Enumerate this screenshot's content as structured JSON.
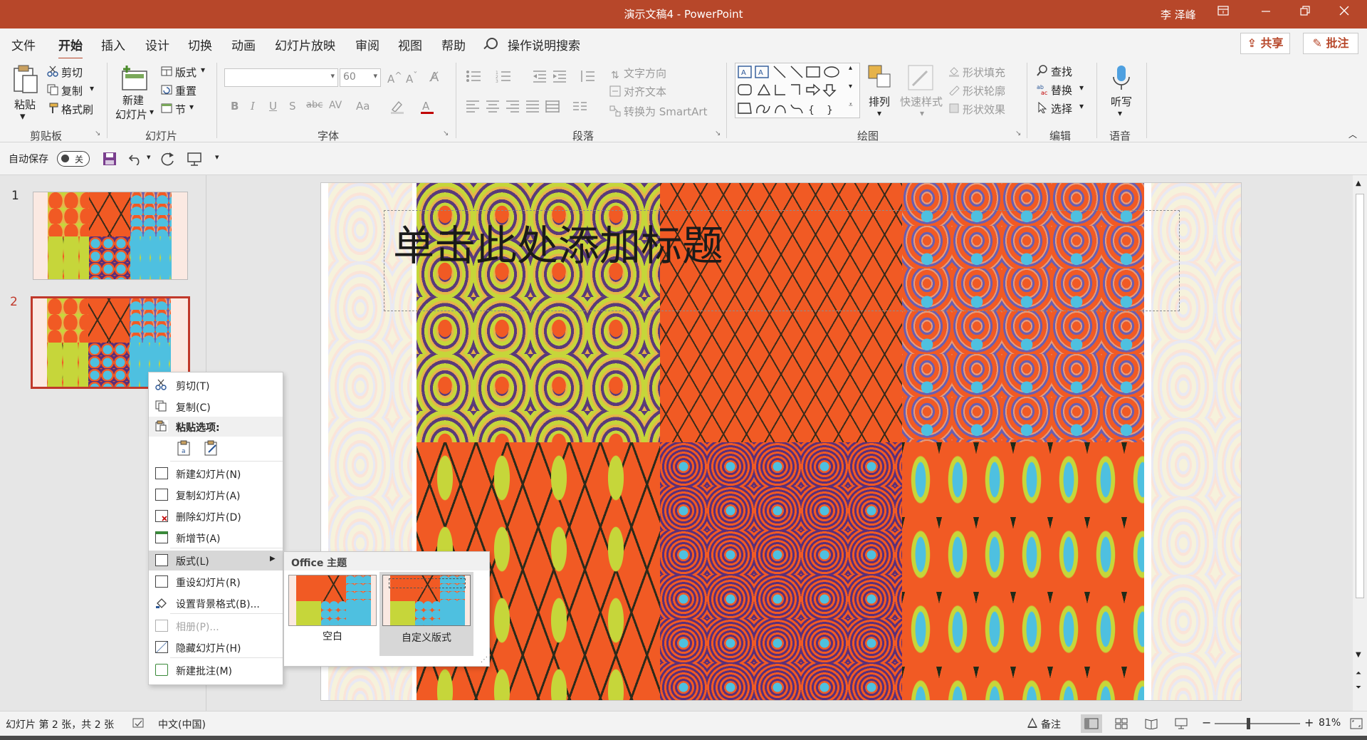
{
  "window": {
    "title": "演示文稿4  -  PowerPoint",
    "user": "李 泽峰",
    "controls": [
      "ribbon-display",
      "minimize",
      "restore",
      "close"
    ]
  },
  "tabs": [
    "文件",
    "开始",
    "插入",
    "设计",
    "切换",
    "动画",
    "幻灯片放映",
    "审阅",
    "视图",
    "帮助"
  ],
  "active_tab": "开始",
  "tell_me": "操作说明搜索",
  "share": "共享",
  "comments": "批注",
  "ribbon": {
    "clipboard": {
      "label": "剪贴板",
      "paste": "粘贴",
      "cut": "剪切",
      "copy": "复制",
      "format_painter": "格式刷"
    },
    "slides": {
      "label": "幻灯片",
      "new_slide": "新建",
      "new_slide_2": "幻灯片",
      "layout": "版式",
      "reset": "重置",
      "section": "节"
    },
    "font": {
      "label": "字体",
      "font_name": "",
      "font_size": "60",
      "bold": "B",
      "italic": "I",
      "underline": "U",
      "shadow": "S",
      "strike": "abc",
      "spacing": "AV",
      "case": "Aa"
    },
    "paragraph": {
      "label": "段落",
      "text_direction": "文字方向",
      "align_text": "对齐文本",
      "smartart": "转换为 SmartArt"
    },
    "drawing": {
      "label": "绘图",
      "arrange": "排列",
      "quick_styles": "快速样式",
      "shape_fill": "形状填充",
      "shape_outline": "形状轮廓",
      "shape_effects": "形状效果"
    },
    "editing": {
      "label": "编辑",
      "find": "查找",
      "replace": "替换",
      "select": "选择"
    },
    "voice": {
      "label": "语音",
      "dictate": "听写"
    }
  },
  "qat": {
    "autosave": "自动保存",
    "autosave_state": "关"
  },
  "thumbnails": [
    {
      "number": "1"
    },
    {
      "number": "2"
    }
  ],
  "slide": {
    "title_placeholder": "单击此处添加标题"
  },
  "context_menu": {
    "items": [
      {
        "label": "剪切(T)",
        "icon": "scissors-icon"
      },
      {
        "label": "复制(C)",
        "icon": "copy-icon"
      },
      {
        "label": "粘贴选项:",
        "icon": "paste-icon"
      },
      {
        "label": "新建幻灯片(N)",
        "icon": "new-slide-icon"
      },
      {
        "label": "复制幻灯片(A)",
        "icon": "duplicate-slide-icon"
      },
      {
        "label": "删除幻灯片(D)",
        "icon": "delete-slide-icon"
      },
      {
        "label": "新增节(A)",
        "icon": "section-icon"
      },
      {
        "label": "版式(L)",
        "icon": "layout-icon"
      },
      {
        "label": "重设幻灯片(R)",
        "icon": "reset-slide-icon"
      },
      {
        "label": "设置背景格式(B)...",
        "icon": "background-icon"
      },
      {
        "label": "相册(P)...",
        "icon": "album-icon",
        "disabled": true
      },
      {
        "label": "隐藏幻灯片(H)",
        "icon": "hide-slide-icon"
      },
      {
        "label": "新建批注(M)",
        "icon": "comment-icon"
      }
    ]
  },
  "layout_submenu": {
    "header": "Office 主题",
    "options": [
      {
        "label": "空白"
      },
      {
        "label": "自定义版式",
        "selected": true
      }
    ]
  },
  "status": {
    "slide_info": "幻灯片 第 2 张，共 2 张",
    "language": "中文(中国)",
    "notes": "备注",
    "zoom": "81%",
    "zoom_value": 81
  },
  "colors": {
    "accent": "#b7472a",
    "pattern_orange": "#f15a24",
    "pattern_lime": "#c6d63a",
    "pattern_cyan": "#4ec0e0"
  }
}
